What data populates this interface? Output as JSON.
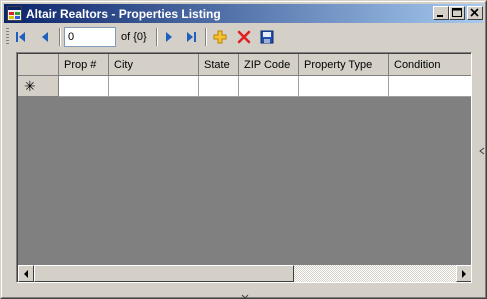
{
  "window": {
    "title": "Altair Realtors - Properties Listing",
    "title_gradient_start": "#0a246a",
    "title_gradient_end": "#a6caf0",
    "icon": "app-form-icon",
    "controls": {
      "minimize_icon": "minimize-icon",
      "maximize_icon": "maximize-icon",
      "close_icon": "close-icon"
    }
  },
  "navigator": {
    "move_first_icon": "move-first-icon",
    "move_previous_icon": "move-previous-icon",
    "position_value": "0",
    "count_label": "of {0}",
    "move_next_icon": "move-next-icon",
    "move_last_icon": "move-last-icon",
    "add_new_icon": "add-new-icon",
    "delete_icon": "delete-icon",
    "save_icon": "save-icon",
    "accent_blue": "#1f5fbf",
    "add_color": "#e0a000",
    "delete_color": "#e02020"
  },
  "grid": {
    "columns": [
      "Prop #",
      "City",
      "State",
      "ZIP Code",
      "Property Type",
      "Condition"
    ],
    "new_row_marker": "✳",
    "rows": [],
    "background_color": "#808080"
  }
}
